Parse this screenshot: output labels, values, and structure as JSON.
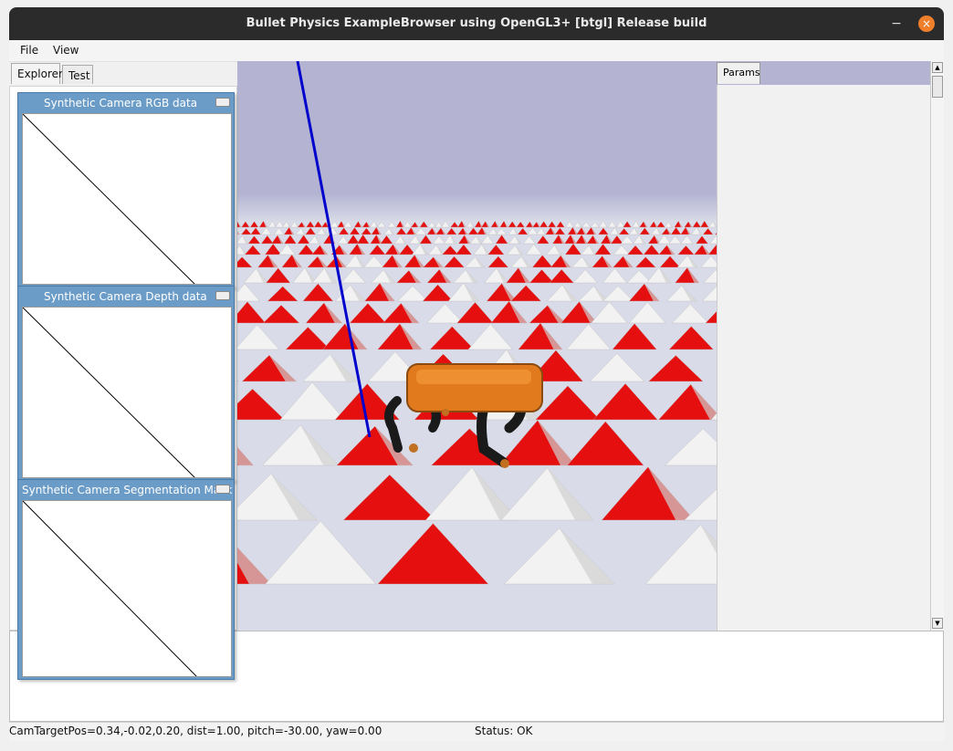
{
  "window": {
    "title": "Bullet Physics ExampleBrowser using OpenGL3+ [btgl] Release build",
    "minimize_glyph": "−",
    "close_glyph": "×"
  },
  "menu": {
    "items": [
      {
        "label": "File"
      },
      {
        "label": "View"
      }
    ]
  },
  "left_tabs": [
    {
      "label": "Explorer",
      "active": true
    },
    {
      "label": "Test",
      "active": false
    }
  ],
  "camera_windows": [
    {
      "title": "Synthetic Camera RGB data"
    },
    {
      "title": "Synthetic Camera Depth data"
    },
    {
      "title": "Synthetic Camera Segmentation Mask"
    }
  ],
  "params": {
    "tab_label": "Params"
  },
  "status": {
    "cam_info": "CamTargetPos=0.34,-0.02,0.20, dist=1.00, pitch=-30.00, yaw=0.00",
    "status_text": "Status: OK"
  },
  "colors": {
    "sky": "#b4b4d2",
    "terrain_red": "#e60f0f",
    "terrain_white": "#f2f2f2",
    "robot_body": "#e07a1c",
    "robot_legs": "#1a1a1a",
    "camera_window_frame": "#6b9cc8",
    "title_bar": "#2b2b2b",
    "close_button": "#f07f2b",
    "axis_line": "#0000cc"
  },
  "icons": {
    "minimize": "minimize-icon",
    "close": "close-icon",
    "scroll_up": "triangle-up-icon",
    "scroll_down": "triangle-down-icon"
  }
}
